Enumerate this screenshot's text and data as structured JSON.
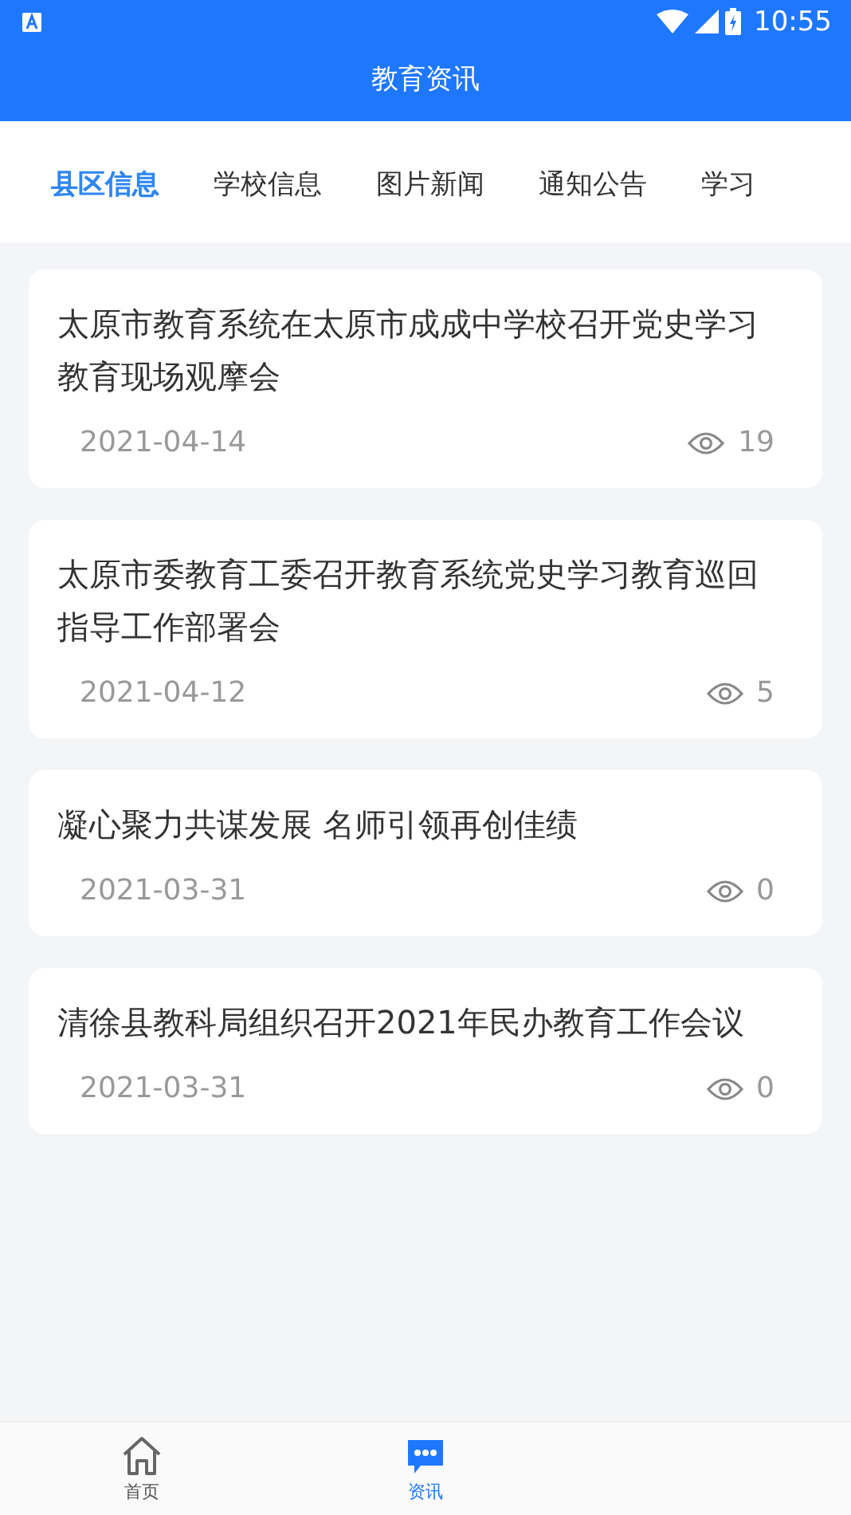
{
  "status_bar": {
    "time": "10:55"
  },
  "header": {
    "title": "教育资讯"
  },
  "tabs": [
    {
      "label": "县区信息",
      "selected": true
    },
    {
      "label": "学校信息",
      "selected": false
    },
    {
      "label": "图片新闻",
      "selected": false
    },
    {
      "label": "通知公告",
      "selected": false
    },
    {
      "label": "学习",
      "selected": false
    }
  ],
  "articles": [
    {
      "title": "太原市教育系统在太原市成成中学校召开党史学习教育现场观摩会",
      "date": "2021-04-14",
      "views": "19"
    },
    {
      "title": "太原市委教育工委召开教育系统党史学习教育巡回指导工作部署会",
      "date": "2021-04-12",
      "views": "5"
    },
    {
      "title": "凝心聚力共谋发展 名师引领再创佳绩",
      "date": "2021-03-31",
      "views": "0"
    },
    {
      "title": "清徐县教科局组织召开2021年民办教育工作会议",
      "date": "2021-03-31",
      "views": "0"
    }
  ],
  "bottom_nav": [
    {
      "label": "首页",
      "kind": "home",
      "selected": false
    },
    {
      "label": "资讯",
      "kind": "news",
      "selected": true
    }
  ]
}
